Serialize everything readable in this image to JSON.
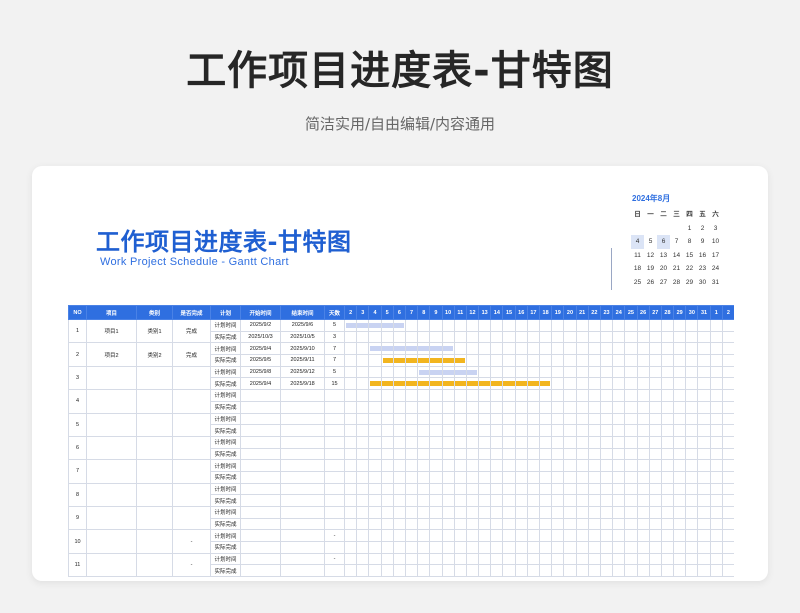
{
  "poster": {
    "title": "工作项目进度表-甘特图",
    "subtitle": "简洁实用/自由编辑/内容通用"
  },
  "document": {
    "title": "工作项目进度表-甘特图",
    "subtitle": "Work Project Schedule - Gantt Chart"
  },
  "calendar": {
    "title": "2024年8月",
    "weekdays": [
      "日",
      "一",
      "二",
      "三",
      "四",
      "五",
      "六"
    ],
    "weeks": [
      [
        "",
        "",
        "",
        "",
        "1",
        "2",
        "3"
      ],
      [
        "4",
        "5",
        "6",
        "7",
        "8",
        "9",
        "10"
      ],
      [
        "11",
        "12",
        "13",
        "14",
        "15",
        "16",
        "17"
      ],
      [
        "18",
        "19",
        "20",
        "21",
        "22",
        "23",
        "24"
      ],
      [
        "25",
        "26",
        "27",
        "28",
        "29",
        "30",
        "31"
      ]
    ],
    "highlighted": [
      "4",
      "6"
    ]
  },
  "table": {
    "headers": [
      "NO",
      "项目",
      "类别",
      "是否完成",
      "计划",
      "开始时间",
      "结束时间",
      "天数"
    ],
    "day_headers": [
      "2",
      "3",
      "4",
      "5",
      "6",
      "7",
      "8",
      "9",
      "10",
      "11",
      "12",
      "13",
      "14",
      "15",
      "16",
      "17",
      "18",
      "19",
      "20",
      "21",
      "22",
      "23",
      "24",
      "25",
      "26",
      "27",
      "28",
      "29",
      "30",
      "31",
      "1",
      "2"
    ],
    "row_labels": {
      "plan": "计划时间",
      "actual": "实际完成"
    },
    "groups": [
      {
        "no": "1",
        "project": "项目1",
        "category": "类别1",
        "done": "完成",
        "plan": {
          "start": "2025/9/2",
          "end": "2025/9/6",
          "days": "5",
          "bar": [
            2,
            6
          ]
        },
        "actual": {
          "start": "2025/10/3",
          "end": "2025/10/5",
          "days": "3",
          "bar": null
        }
      },
      {
        "no": "2",
        "project": "项目2",
        "category": "类别2",
        "done": "完成",
        "plan": {
          "start": "2025/9/4",
          "end": "2025/9/10",
          "days": "7",
          "bar": [
            4,
            10
          ]
        },
        "actual": {
          "start": "2025/9/5",
          "end": "2025/9/11",
          "days": "7",
          "bar": [
            5,
            11
          ]
        }
      },
      {
        "no": "3",
        "project": "",
        "category": "",
        "done": "",
        "plan": {
          "start": "2025/9/8",
          "end": "2025/9/12",
          "days": "5",
          "bar": [
            8,
            12
          ]
        },
        "actual": {
          "start": "2025/9/4",
          "end": "2025/9/18",
          "days": "15",
          "bar": [
            4,
            18
          ]
        }
      },
      {
        "no": "4",
        "project": "",
        "category": "",
        "done": "",
        "plan": {
          "start": "",
          "end": "",
          "days": "",
          "bar": null
        },
        "actual": {
          "start": "",
          "end": "",
          "days": "",
          "bar": null
        }
      },
      {
        "no": "5",
        "project": "",
        "category": "",
        "done": "",
        "plan": {
          "start": "",
          "end": "",
          "days": "",
          "bar": null
        },
        "actual": {
          "start": "",
          "end": "",
          "days": "",
          "bar": null
        }
      },
      {
        "no": "6",
        "project": "",
        "category": "",
        "done": "",
        "plan": {
          "start": "",
          "end": "",
          "days": "",
          "bar": null
        },
        "actual": {
          "start": "",
          "end": "",
          "days": "",
          "bar": null
        }
      },
      {
        "no": "7",
        "project": "",
        "category": "",
        "done": "",
        "plan": {
          "start": "",
          "end": "",
          "days": "",
          "bar": null
        },
        "actual": {
          "start": "",
          "end": "",
          "days": "",
          "bar": null
        }
      },
      {
        "no": "8",
        "project": "",
        "category": "",
        "done": "",
        "plan": {
          "start": "",
          "end": "",
          "days": "",
          "bar": null
        },
        "actual": {
          "start": "",
          "end": "",
          "days": "",
          "bar": null
        }
      },
      {
        "no": "9",
        "project": "",
        "category": "",
        "done": "",
        "plan": {
          "start": "",
          "end": "",
          "days": "",
          "bar": null
        },
        "actual": {
          "start": "",
          "end": "",
          "days": "",
          "bar": null
        }
      },
      {
        "no": "10",
        "project": "",
        "category": "",
        "done": "-",
        "plan": {
          "start": "",
          "end": "",
          "days": "-",
          "bar": null
        },
        "actual": {
          "start": "",
          "end": "",
          "days": "",
          "bar": null
        }
      },
      {
        "no": "11",
        "project": "",
        "category": "",
        "done": "-",
        "plan": {
          "start": "",
          "end": "",
          "days": "-",
          "bar": null
        },
        "actual": {
          "start": "",
          "end": "",
          "days": "",
          "bar": null
        }
      }
    ]
  },
  "colors": {
    "header_blue": "#2f6fe0",
    "plan_bar": "#c9d3f2",
    "actual_bar": "#f2b51f",
    "title_blue": "#1f5fd1"
  }
}
